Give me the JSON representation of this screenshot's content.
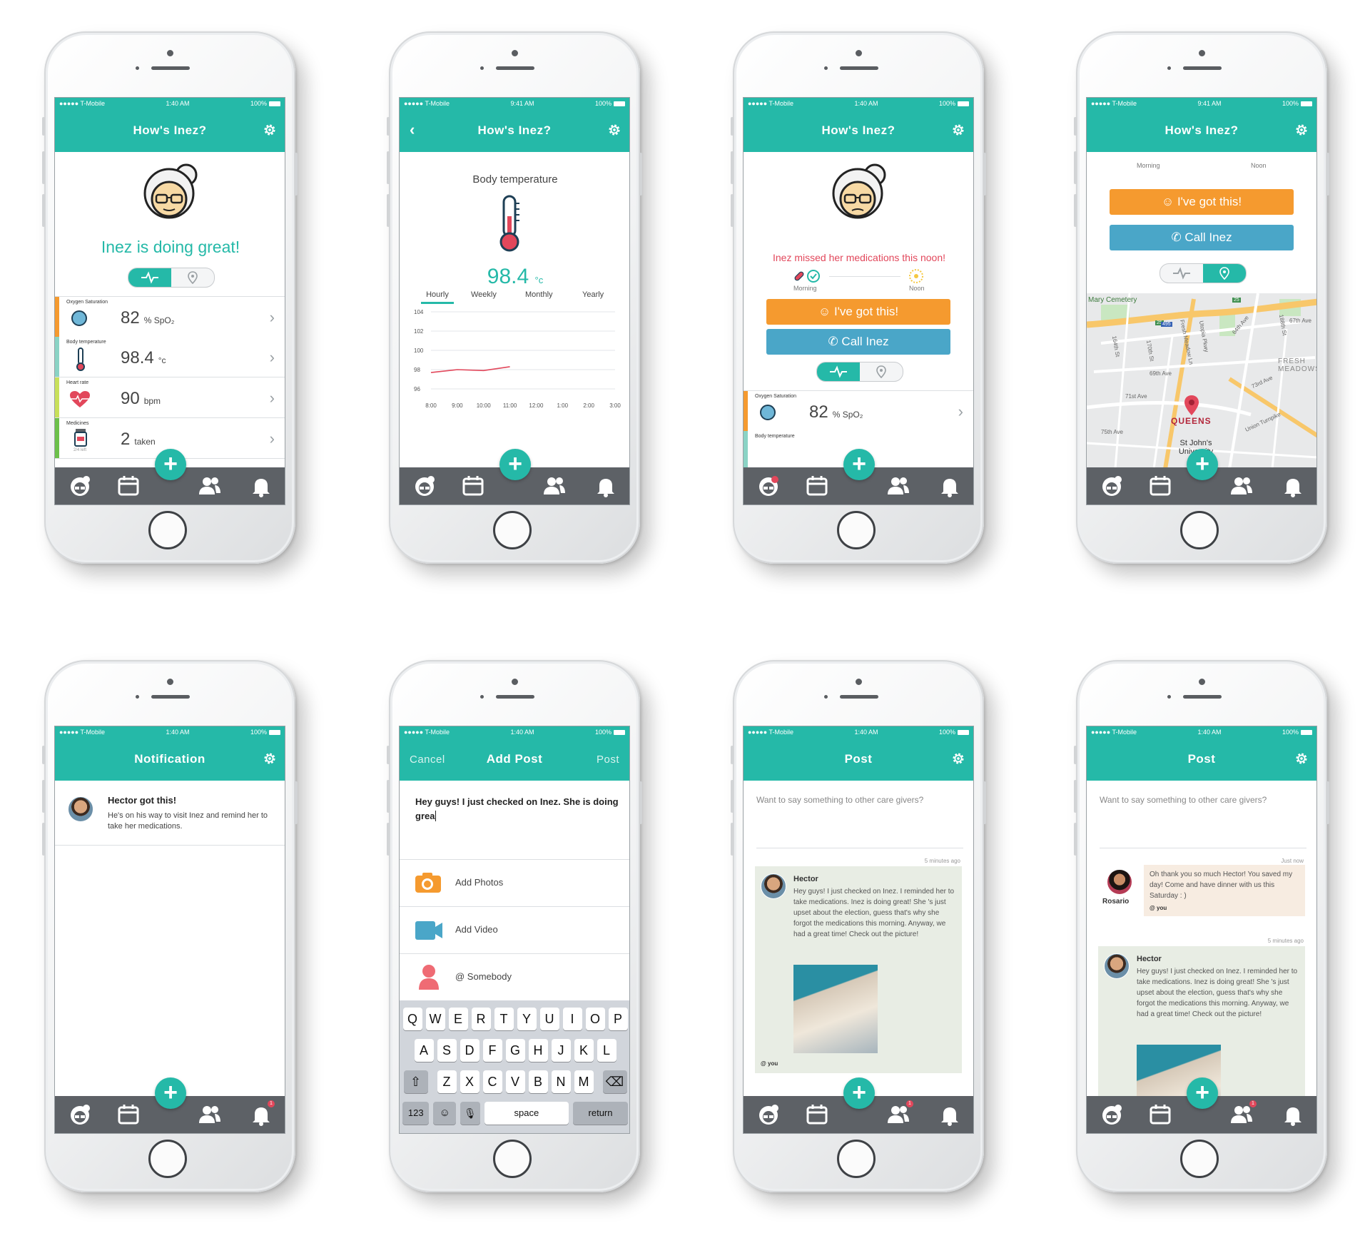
{
  "colors": {
    "teal": "#25b9a8",
    "orange": "#f59a2f",
    "blue": "#4aa6c8",
    "red": "#e2475b",
    "tabbar": "#5d6166"
  },
  "status": {
    "carrier": "●●●●● T-Mobile",
    "time_a": "1:40 AM",
    "time_b": "9:41 AM",
    "battery": "100%"
  },
  "titles": {
    "hows_inez": "How's Inez?",
    "notification": "Notification",
    "add_post": "Add Post",
    "post": "Post"
  },
  "nav": {
    "cancel": "Cancel",
    "post_action": "Post"
  },
  "home": {
    "headline": "Inez is doing great!"
  },
  "vitals": {
    "oxygen": {
      "label": "Oxygen Saturation",
      "value": "82",
      "unit": "% SpO₂"
    },
    "temperature": {
      "label": "Body temperature",
      "value": "98.4",
      "unit": "°c"
    },
    "heart": {
      "label": "Heart rate",
      "value": "90",
      "unit": "bpm"
    },
    "medicines": {
      "label": "Medicines",
      "value": "2",
      "unit": "taken",
      "sub": "2/4 left"
    }
  },
  "temp_screen": {
    "title": "Body temperature",
    "value": "98.4",
    "unit": "°c",
    "tabs": [
      "Hourly",
      "Weekly",
      "Monthly",
      "Yearly"
    ]
  },
  "chart_data": {
    "type": "line",
    "x": [
      "8:00",
      "9:00",
      "10:00",
      "11:00",
      "12:00",
      "1:00",
      "2:00",
      "3:00"
    ],
    "series": [
      {
        "values": [
          97.7,
          98.0,
          97.9,
          98.3,
          null,
          null,
          null,
          null
        ]
      }
    ],
    "yticks": [
      "104",
      "102",
      "100",
      "98",
      "96"
    ],
    "ylim": [
      96,
      104
    ],
    "grid": true
  },
  "alert": {
    "message": "Inez missed her medications this noon!",
    "morning": "Morning",
    "noon": "Noon",
    "got_this": "I've got this!",
    "call": "Call Inez"
  },
  "map": {
    "cemetery": "Mary Cemetery",
    "queens": "QUEENS",
    "fresh_meadows": "FRESH MEADOWS",
    "university": "St John's University",
    "streets": [
      "64th Ave",
      "69th Ave",
      "71st Ave",
      "73rd Ave",
      "75th Ave",
      "Union Turnpike",
      "Utopia Pkwy",
      "188th St",
      "164th St",
      "170th St",
      "Fresh Meadow Ln",
      "67th Ave"
    ],
    "shields": [
      "25",
      "495",
      "25"
    ]
  },
  "notification": {
    "title": "Hector got this!",
    "body": "He's on his way to visit Inez and remind her to take her medications."
  },
  "add_post": {
    "draft": "Hey guys! I just checked on Inez. She is doing grea",
    "photos": "Add Photos",
    "video": "Add Video",
    "somebody": "@ Somebody"
  },
  "keyboard": {
    "row1": [
      "Q",
      "W",
      "E",
      "R",
      "T",
      "Y",
      "U",
      "I",
      "O",
      "P"
    ],
    "row2": [
      "A",
      "S",
      "D",
      "F",
      "G",
      "H",
      "J",
      "K",
      "L"
    ],
    "row3": [
      "Z",
      "X",
      "C",
      "V",
      "B",
      "N",
      "M"
    ],
    "num": "123",
    "space": "space",
    "return": "return"
  },
  "feed": {
    "prompt": "Want to say something to other care givers?",
    "time_hector": "5 minutes ago",
    "time_rosario": "Just now",
    "hector_name": "Hector",
    "hector_body": "Hey guys! I just checked on Inez. I reminded her to take medications. Inez is doing great! She 's just upset about the election, guess that's why she forgot the medications this morning. Anyway, we had a great time! Check out the picture!",
    "you_tag": "@ you",
    "rosario_name": "Rosario",
    "rosario_body": "Oh thank you so much Hector! You saved my day! Come and have dinner with us this Saturday : )"
  },
  "badges": {
    "one": "1"
  }
}
